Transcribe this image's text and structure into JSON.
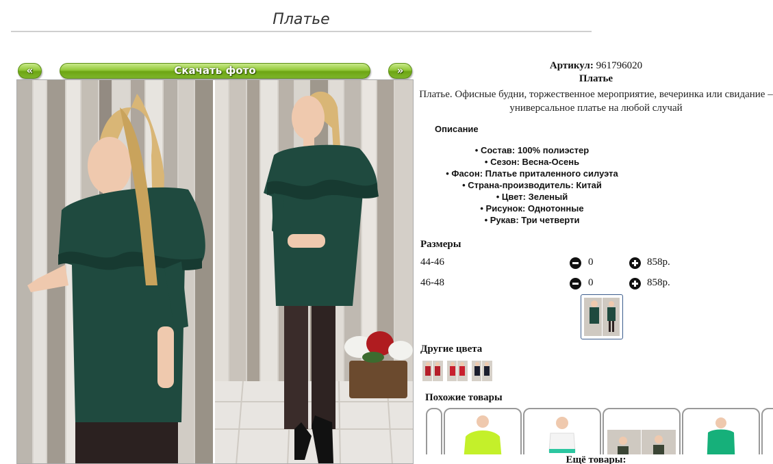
{
  "page": {
    "title": "Платье"
  },
  "nav": {
    "prev_label": "«",
    "download_label": "Скачать фото",
    "next_label": "»"
  },
  "product": {
    "article_label": "Артикул:",
    "article_value": "961796020",
    "name": "Платье",
    "description": "Платье. Офисные будни, торжественное мероприятие, вечеринка или свидание – универсальное платье на любой случай"
  },
  "description_section": {
    "heading": "Описание",
    "specs": [
      "• Состав: 100% полиэстер",
      "• Сезон: Весна-Осень",
      "• Фасон: Платье приталенного силуэта",
      "• Страна-производитель: Китай",
      "• Цвет: Зеленый",
      "• Рисунок: Однотонные",
      "• Рукав: Три четверти"
    ]
  },
  "sizes": {
    "heading": "Размеры",
    "rows": [
      {
        "size": "44-46",
        "qty": "0",
        "price": "858р."
      },
      {
        "size": "46-48",
        "qty": "0",
        "price": "858р."
      }
    ]
  },
  "other_colors": {
    "heading": "Другие цвета"
  },
  "similar": {
    "heading": "Похожие товары",
    "more_label": "Ещё товары:"
  },
  "colors": {
    "accent_green": "#7db52a",
    "dress_green": "#1f4a3f",
    "thumb_border": "#3a5b8c"
  }
}
